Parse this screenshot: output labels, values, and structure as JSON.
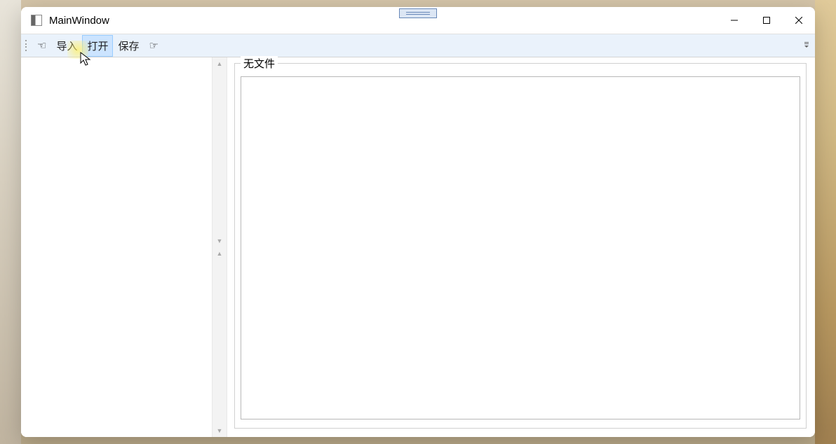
{
  "window": {
    "title": "MainWindow"
  },
  "toolbar": {
    "hand_left_icon": "hand-left",
    "import_label": "导入",
    "open_label": "打开",
    "save_label": "保存",
    "hand_right_icon": "hand-right"
  },
  "main": {
    "groupbox_title": "无文件"
  }
}
